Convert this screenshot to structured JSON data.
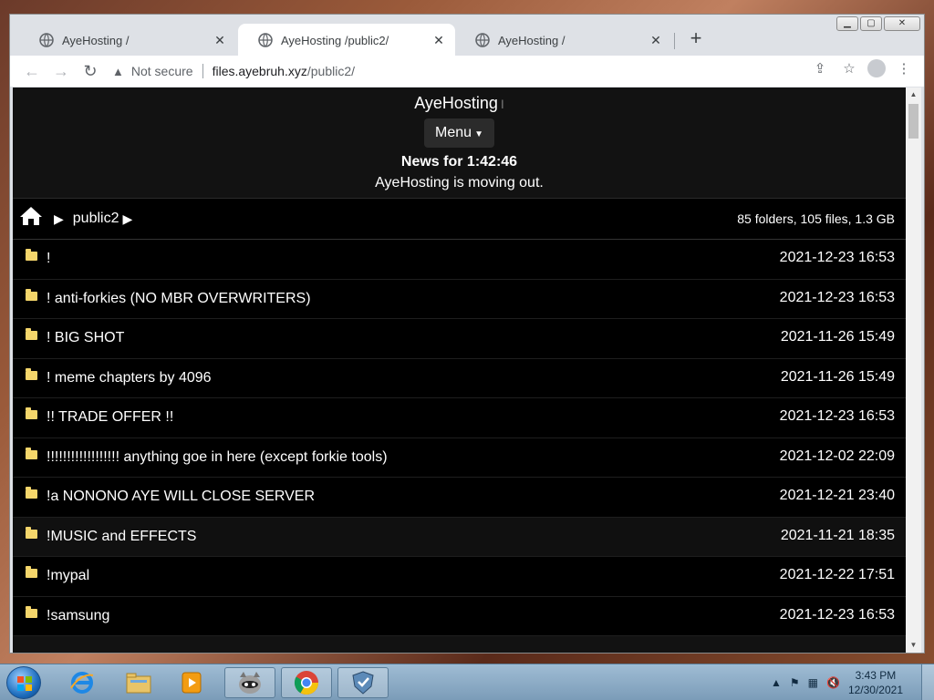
{
  "browser": {
    "tabs": [
      {
        "title": "AyeHosting /",
        "active": false
      },
      {
        "title": "AyeHosting /public2/",
        "active": true
      },
      {
        "title": "AyeHosting /",
        "active": false
      }
    ],
    "new_tab_symbol": "+",
    "url": {
      "security_label": "Not secure",
      "host": "files.ayebruh.xyz",
      "path": "/public2/"
    }
  },
  "site": {
    "brand": "AyeHosting",
    "menu_label": "Menu",
    "news_title": "News for 1:42:46",
    "news_text": "AyeHosting is moving out."
  },
  "breadcrumb": {
    "folder": "public2",
    "stats": "85 folders, 105 files, 1.3 GB"
  },
  "files": [
    {
      "name": "!",
      "date": "2021-12-23 16:53"
    },
    {
      "name": "! anti-forkies (NO MBR OVERWRITERS)",
      "date": "2021-12-23 16:53"
    },
    {
      "name": "! BIG SHOT",
      "date": "2021-11-26 15:49"
    },
    {
      "name": "! meme chapters by 4096",
      "date": "2021-11-26 15:49"
    },
    {
      "name": "!! TRADE OFFER !!",
      "date": "2021-12-23 16:53"
    },
    {
      "name": "!!!!!!!!!!!!!!!!!! anything goe in here (except forkie tools)",
      "date": "2021-12-02 22:09"
    },
    {
      "name": "!a NONONO AYE WILL CLOSE SERVER",
      "date": "2021-12-21 23:40"
    },
    {
      "name": "!MUSIC and EFFECTS",
      "date": "2021-11-21 18:35"
    },
    {
      "name": "!mypal",
      "date": "2021-12-22 17:51"
    },
    {
      "name": "!samsung",
      "date": "2021-12-23 16:53"
    }
  ],
  "taskbar": {
    "time": "3:43 PM",
    "date": "12/30/2021"
  },
  "icons": [
    "globe-icon",
    "home-icon",
    "folder-icon",
    "back-icon",
    "forward-icon",
    "reload-icon",
    "warning-icon",
    "share-icon",
    "star-icon",
    "profile-icon",
    "kebab-menu-icon",
    "start-orb-icon",
    "ie-icon",
    "explorer-icon",
    "media-player-icon",
    "raccoon-app-icon",
    "chrome-icon",
    "shield-app-icon",
    "flag-icon",
    "network-icon",
    "volume-muted-icon"
  ]
}
